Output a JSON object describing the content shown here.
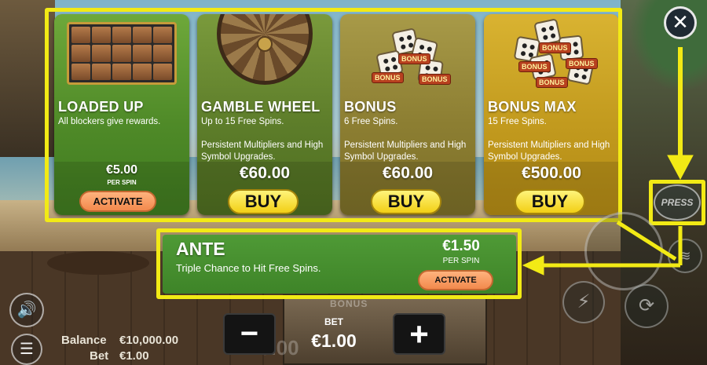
{
  "cards": [
    {
      "title": "LOADED UP",
      "desc": "All blockers give rewards.",
      "desc2": "",
      "price": "€5.00",
      "per_spin": "PER SPIN",
      "button": "ACTIVATE"
    },
    {
      "title": "GAMBLE WHEEL",
      "desc": "Up to 15 Free Spins.",
      "desc2": "Persistent Multipliers and High Symbol Upgrades.",
      "price": "€60.00",
      "button": "BUY"
    },
    {
      "title": "BONUS",
      "desc": "6 Free Spins.",
      "desc2": "Persistent Multipliers and High Symbol Upgrades.",
      "price": "€60.00",
      "button": "BUY"
    },
    {
      "title": "BONUS MAX",
      "desc": "15 Free Spins.",
      "desc2": "Persistent Multipliers and High Symbol Upgrades.",
      "price": "€500.00",
      "button": "BUY"
    }
  ],
  "dice_tag": "BONUS",
  "ante": {
    "title": "ANTE",
    "desc": "Triple Chance to Hit Free Spins.",
    "price": "€1.50",
    "per_spin": "PER SPIN",
    "button": "ACTIVATE"
  },
  "controls": {
    "close": "✕",
    "press": "PRESS",
    "minus": "−",
    "plus": "+",
    "bet_title": "BET",
    "bet_amount": "€1.00",
    "sound_icon": "🔊",
    "menu_icon": "☰",
    "coins_icon": "≋",
    "turbo_icon": "⚡",
    "auto_icon": "⟳"
  },
  "footer": {
    "balance_label": "Balance",
    "balance_value": "€10,000.00",
    "bet_label": "Bet",
    "bet_value": "€1.00"
  },
  "background": {
    "bonus_sign": "BONUS",
    "ghost_win": "0.00"
  },
  "colors": {
    "highlight": "#f2ea15",
    "buy_button": "#f2cf15",
    "activate_button": "#f2894d",
    "ante_panel": "#3e8428"
  }
}
